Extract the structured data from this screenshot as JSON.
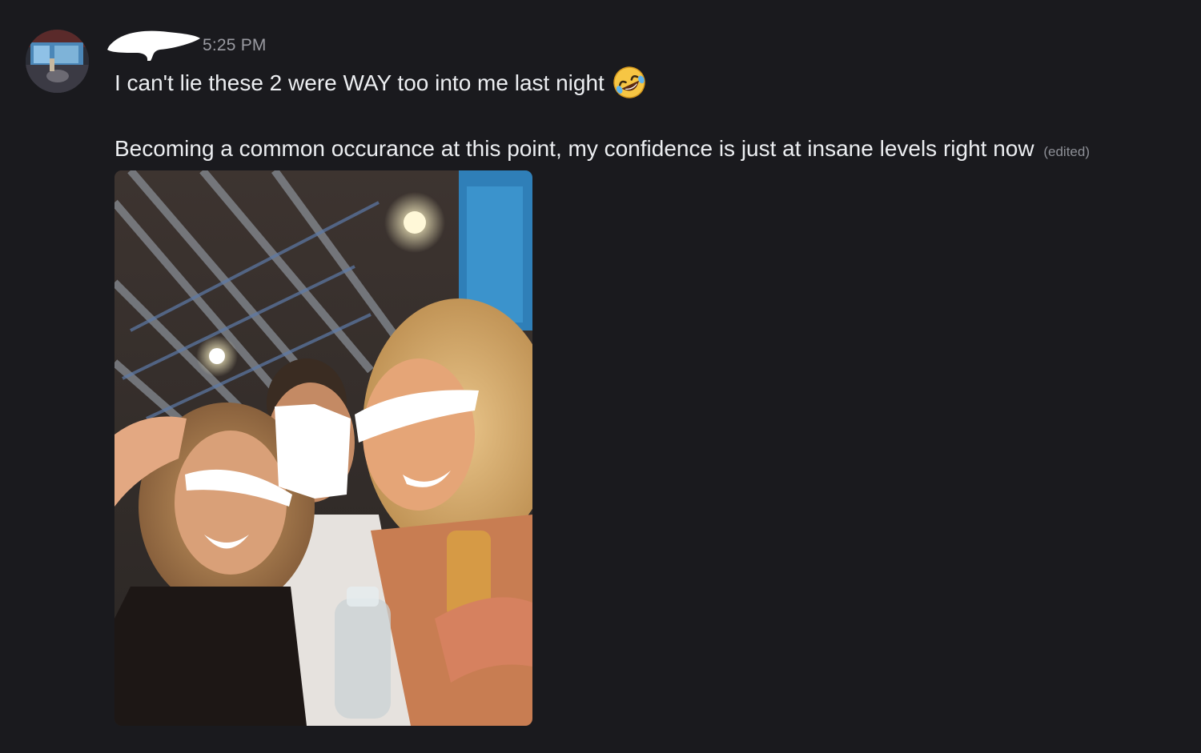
{
  "message": {
    "timestamp": "5:25 PM",
    "line1": "I can't lie these 2 were WAY too into me last night",
    "emoji": "rolling-on-floor-laughing-emoji",
    "line2": "Becoming a common occurance at this point, my confidence is just at insane levels right now",
    "edited": "(edited)"
  },
  "colors": {
    "background": "#1a1a1e",
    "text": "#eceef1",
    "muted": "#9a9ba2"
  }
}
